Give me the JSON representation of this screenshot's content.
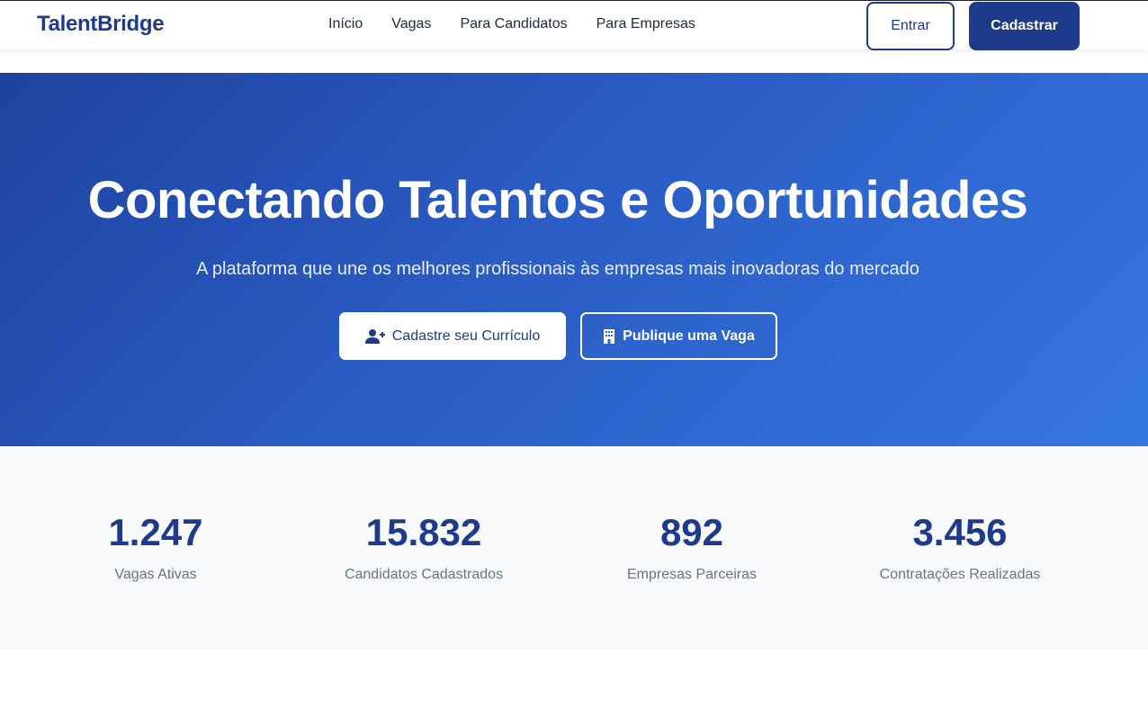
{
  "header": {
    "logo": "TalentBridge",
    "nav": [
      "Início",
      "Vagas",
      "Para Candidatos",
      "Para Empresas"
    ],
    "login_label": "Entrar",
    "signup_label": "Cadastrar"
  },
  "hero": {
    "title": "Conectando Talentos e Oportunidades",
    "subtitle": "A plataforma que une os melhores profissionais às empresas mais inovadoras do mercado",
    "primary_button": "Cadastre seu Currículo",
    "secondary_button": "Publique uma Vaga",
    "primary_icon": "user-plus-icon",
    "secondary_icon": "building-icon"
  },
  "stats": [
    {
      "value": "1.247",
      "label": "Vagas Ativas"
    },
    {
      "value": "15.832",
      "label": "Candidatos Cadastrados"
    },
    {
      "value": "892",
      "label": "Empresas Parceiras"
    },
    {
      "value": "3.456",
      "label": "Contratações Realizadas"
    }
  ],
  "colors": {
    "brand": "#1e3a8a",
    "hero_gradient_start": "#1e429f",
    "hero_gradient_end": "#3576e0",
    "stats_bg": "#f8f9fb"
  }
}
